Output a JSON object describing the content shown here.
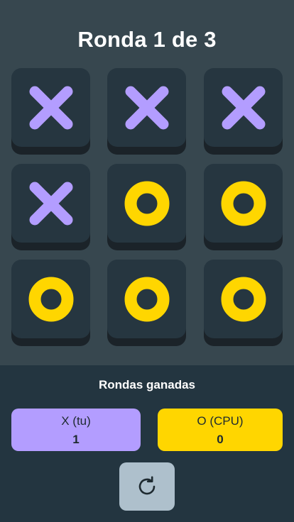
{
  "header": {
    "title": "Ronda 1 de 3"
  },
  "board": {
    "cells": [
      "X",
      "X",
      "X",
      "X",
      "O",
      "O",
      "O",
      "O",
      "O"
    ]
  },
  "colors": {
    "x_mark": "#b39dff",
    "o_mark": "#ffd600",
    "cell_face": "#263640",
    "background": "#37474f",
    "panel": "#233540"
  },
  "scoreboard": {
    "title": "Rondas ganadas",
    "player_x": {
      "label": "X (tu)",
      "value": "1"
    },
    "player_o": {
      "label": "O (CPU)",
      "value": "0"
    }
  },
  "controls": {
    "restart_icon": "restart-icon"
  }
}
